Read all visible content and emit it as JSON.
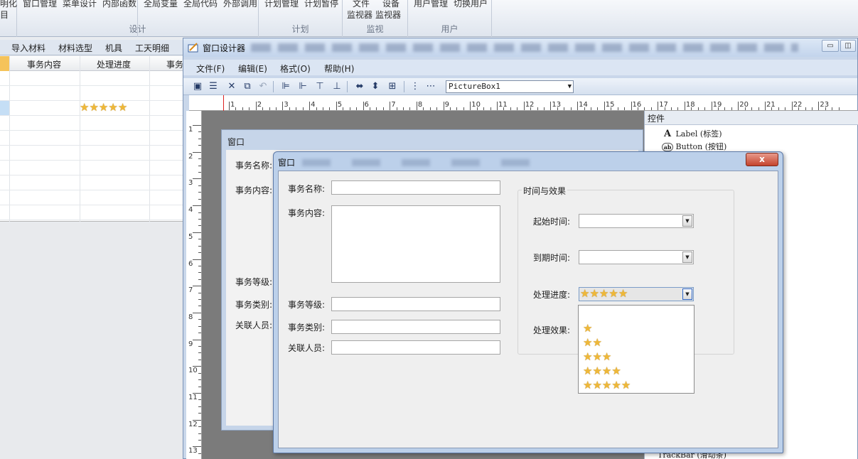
{
  "ribbon": {
    "groups": [
      {
        "items": [
          "窗口管理",
          "菜单设计",
          "内部函数"
        ],
        "items_left": [
          "明化",
          "目"
        ],
        "label": "设计"
      },
      {
        "items": [
          "全局变量",
          "全局代码",
          "外部调用"
        ],
        "label": ""
      },
      {
        "items": [
          "计划管理",
          "计划暂停"
        ],
        "label": "计划"
      },
      {
        "items": [
          "文件",
          "设备"
        ],
        "items2": [
          "监视器",
          "监视器"
        ],
        "label": "监视"
      },
      {
        "items": [
          "用户管理",
          "切换用户"
        ],
        "label": "用户"
      }
    ]
  },
  "bg": {
    "tabs": [
      "导入材料",
      "材料选型",
      "机具",
      "工天明细"
    ],
    "columns": [
      "事务内容",
      "处理进度",
      "事务"
    ],
    "rating_row": {
      "stars": 5
    }
  },
  "designer": {
    "title": "窗口设计器",
    "menu": [
      "文件(F)",
      "编辑(E)",
      "格式(O)",
      "帮助(H)"
    ],
    "object_combo": "PictureBox1",
    "ruler_h": [
      "1",
      "2",
      "3",
      "4",
      "5",
      "6",
      "7",
      "8",
      "9",
      "10",
      "11",
      "12",
      "13",
      "14",
      "15",
      "16",
      "17",
      "18",
      "19",
      "20",
      "21",
      "22",
      "23"
    ],
    "ruler_v": [
      "1",
      "2",
      "3",
      "4",
      "5",
      "6",
      "7",
      "8",
      "9",
      "10",
      "11",
      "12",
      "13"
    ],
    "form_preview": {
      "title": "窗口",
      "labels": [
        "事务名称:",
        "事务内容:",
        "事务等级:",
        "事务类别:",
        "关联人员:"
      ]
    },
    "toolbox": {
      "header": "控件",
      "items": [
        {
          "icon": "A",
          "label": "Label (标签)"
        },
        {
          "icon": "ab",
          "label": "Button (按钮)"
        }
      ],
      "bottom_item": "TrackBar (滑动条)"
    }
  },
  "dialog": {
    "title": "窗口",
    "close_label": "x",
    "fields": {
      "name_label": "事务名称:",
      "content_label": "事务内容:",
      "level_label": "事务等级:",
      "category_label": "事务类别:",
      "people_label": "关联人员:"
    },
    "group": {
      "legend": "时间与效果",
      "start_label": "起始时间:",
      "due_label": "到期时间:",
      "progress_label": "处理进度:",
      "effect_label": "处理效果:",
      "progress_selected_stars": 5,
      "dropdown_options": [
        1,
        2,
        3,
        4,
        5
      ]
    }
  },
  "colors": {
    "star": "#efb838",
    "selection": "#f5c35a",
    "close": "#c4432d"
  }
}
